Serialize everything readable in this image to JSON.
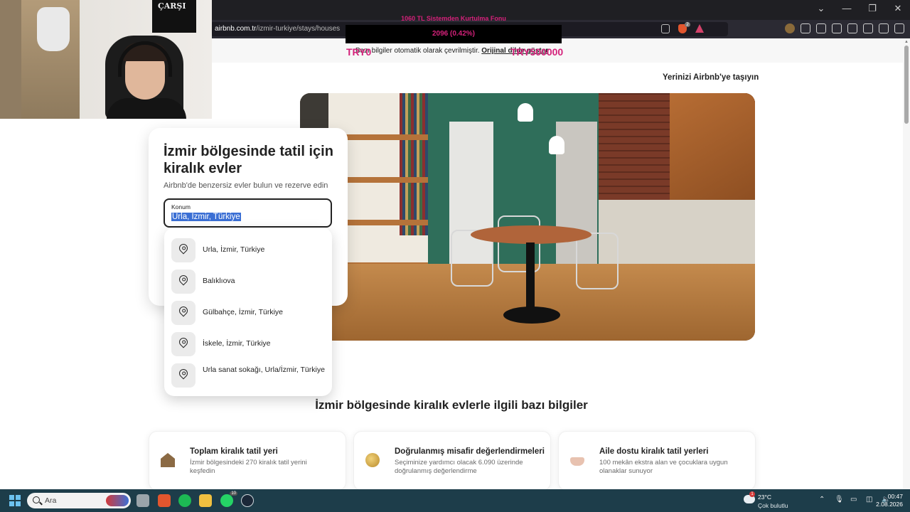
{
  "browser": {
    "url_host": "airbnb.com.tr",
    "url_path": "/izmir-turkiye/stays/houses",
    "window_controls": [
      "⌄",
      "—",
      "❐",
      "✕"
    ]
  },
  "overlay": {
    "title": "1060 TL Sistemden Kurtulma Fonu",
    "progress": "2096 (0.42%)",
    "left_value": "TRY0",
    "right_value": "TRY500000"
  },
  "translate_bar": {
    "text": "Bazı bilgiler otomatik olarak çevrilmiştir.",
    "link": "Orijinal dilde göster"
  },
  "header": {
    "host_link": "Yerinizi Airbnb'ye taşıyın"
  },
  "search_card": {
    "title": "İzmir bölgesinde tatil için kiralık evler",
    "subtitle": "Airbnb'de benzersiz evler bulun ve rezerve edin",
    "location_label": "Konum",
    "location_value": "Urla, İzmir, Türkiye"
  },
  "suggestions": [
    {
      "label": "Urla, İzmir, Türkiye",
      "icon": "map-pin-icon"
    },
    {
      "label": "Balıklıova",
      "icon": "map-pin-icon"
    },
    {
      "label": "Gülbahçe, İzmir, Türkiye",
      "icon": "map-pin-icon"
    },
    {
      "label": "İskele, İzmir, Türkiye",
      "icon": "map-pin-icon"
    },
    {
      "label": "Urla sanat sokağı, Urla/İzmir, Türkiye",
      "icon": "map-pin-icon"
    }
  ],
  "info_section": {
    "title": "İzmir bölgesinde kiralık evlerle ilgili bazı bilgiler",
    "cards": [
      {
        "title": "Toplam kiralık tatil yeri",
        "desc": "İzmir bölgesindeki 270 kiralık tatil yerini keşfedin",
        "icon": "house-icon"
      },
      {
        "title": "Doğrulanmış misafir değerlendirmeleri",
        "desc": "Seçiminize yardımcı olacak 6.090 üzerinde doğrulanmış değerlendirme",
        "icon": "coin-icon"
      },
      {
        "title": "Aile dostu kiralık tatil yerleri",
        "desc": "100 mekân ekstra alan ve çocuklara uygun olanaklar sunuyor",
        "icon": "bathtub-icon"
      }
    ]
  },
  "taskbar": {
    "search_placeholder": "Ara",
    "weather_temp": "23°C",
    "weather_desc": "Çok bulutlu",
    "weather_alert": "1",
    "time": "00:47",
    "date": "2.08.2026",
    "whatsapp_badge": "10"
  },
  "webcam": {
    "poster_text": "ÇARŞI"
  },
  "colors": {
    "overlay_accent": "#d4217a",
    "selection": "#3b6fd4",
    "taskbar": "#1d3d4a"
  }
}
